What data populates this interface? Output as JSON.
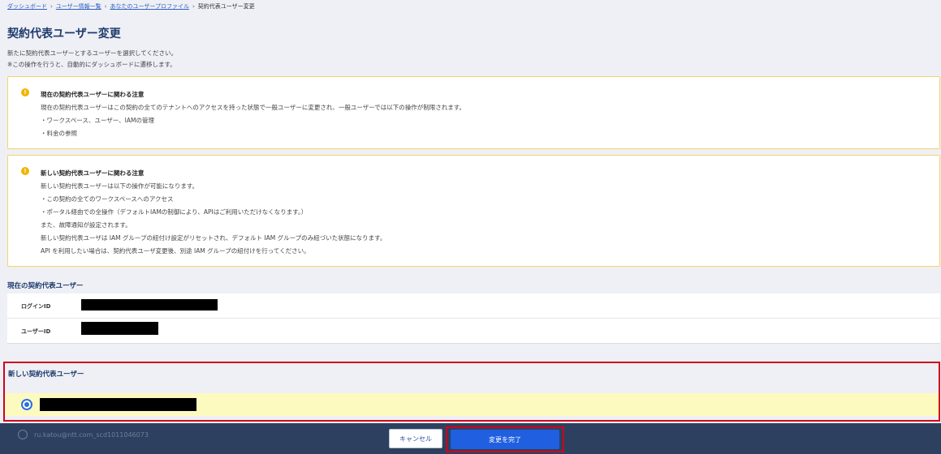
{
  "breadcrumb": {
    "items": [
      "ダッシュボード",
      "ユーザー情報一覧",
      "あなたのユーザープロファイル"
    ],
    "separator": "›",
    "current": "契約代表ユーザー変更"
  },
  "page": {
    "title": "契約代表ユーザー変更",
    "description1": "新たに契約代表ユーザーとするユーザーを選択してください。",
    "description2": "※この操作を行うと、自動的にダッシュボードに遷移します。"
  },
  "notice_current": {
    "title": "現在の契約代表ユーザーに関わる注意",
    "lines": [
      "現在の契約代表ユーザーはこの契約の全てのテナントへのアクセスを持った状態で一般ユーザーに変更され、一般ユーザーでは以下の操作が制限されます。",
      "・ワークスペース、ユーザー、IAMの管理",
      "・料金の参照"
    ]
  },
  "notice_new": {
    "title": "新しい契約代表ユーザーに関わる注意",
    "lines": [
      "新しい契約代表ユーザーは以下の操作が可能になります。",
      "・この契約の全てのワークスペースへのアクセス",
      "・ポータル経由での全操作（デフォルトIAMの制御により、APIはご利用いただけなくなります。）",
      "また、故障通知が設定されます。",
      "新しい契約代表ユーザは IAM グループの紐付け設定がリセットされ、デフォルト IAM グループのみ紐づいた状態になります。",
      "API を利用したい場合は、契約代表ユーザ変更後、別途 IAM グループの紐付けを行ってください。"
    ]
  },
  "current_user": {
    "section_title": "現在の契約代表ユーザー",
    "login_id_label": "ログインID",
    "user_id_label": "ユーザーID"
  },
  "new_user": {
    "section_title": "新しい契約代表ユーザー"
  },
  "footer": {
    "faded_item": "ru.katou@ntt.com_scd1011046073",
    "cancel_label": "キャンセル",
    "confirm_label": "変更を完了"
  },
  "colors": {
    "accent": "#1f5fe0",
    "highlight_border": "#d0021b",
    "notice_border": "#f3d36b",
    "footer_bg": "#2e4060",
    "selected_row_bg": "#fdfac0"
  }
}
